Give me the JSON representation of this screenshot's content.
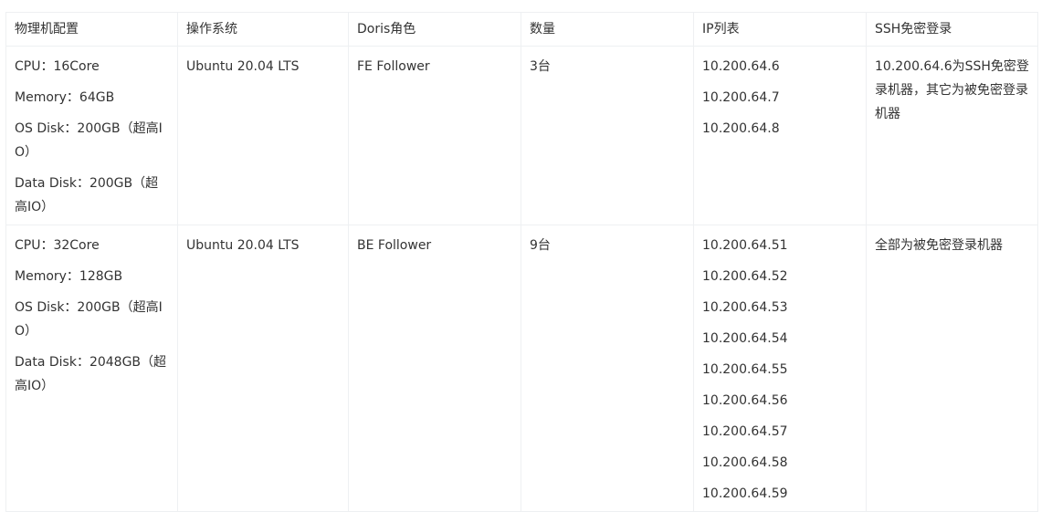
{
  "headers": [
    "物理机配置",
    "操作系统",
    "Doris角色",
    "数量",
    "IP列表",
    "SSH免密登录"
  ],
  "rows": [
    {
      "config": [
        "CPU：16Core",
        "Memory：64GB",
        "OS Disk：200GB（超高IO）",
        "Data Disk：200GB（超高IO）"
      ],
      "os": "Ubuntu 20.04 LTS",
      "role": "FE Follower",
      "count": "3台",
      "ips": [
        "10.200.64.6",
        "10.200.64.7",
        "10.200.64.8"
      ],
      "ssh": "10.200.64.6为SSH免密登录机器，其它为被免密登录机器"
    },
    {
      "config": [
        "CPU：32Core",
        "Memory：128GB",
        "OS Disk：200GB（超高IO）",
        "Data Disk：2048GB（超高IO）"
      ],
      "os": "Ubuntu 20.04 LTS",
      "role": "BE Follower",
      "count": "9台",
      "ips": [
        "10.200.64.51",
        "10.200.64.52",
        "10.200.64.53",
        "10.200.64.54",
        "10.200.64.55",
        "10.200.64.56",
        "10.200.64.57",
        "10.200.64.58",
        "10.200.64.59"
      ],
      "ssh": "全部为被免密登录机器"
    }
  ]
}
